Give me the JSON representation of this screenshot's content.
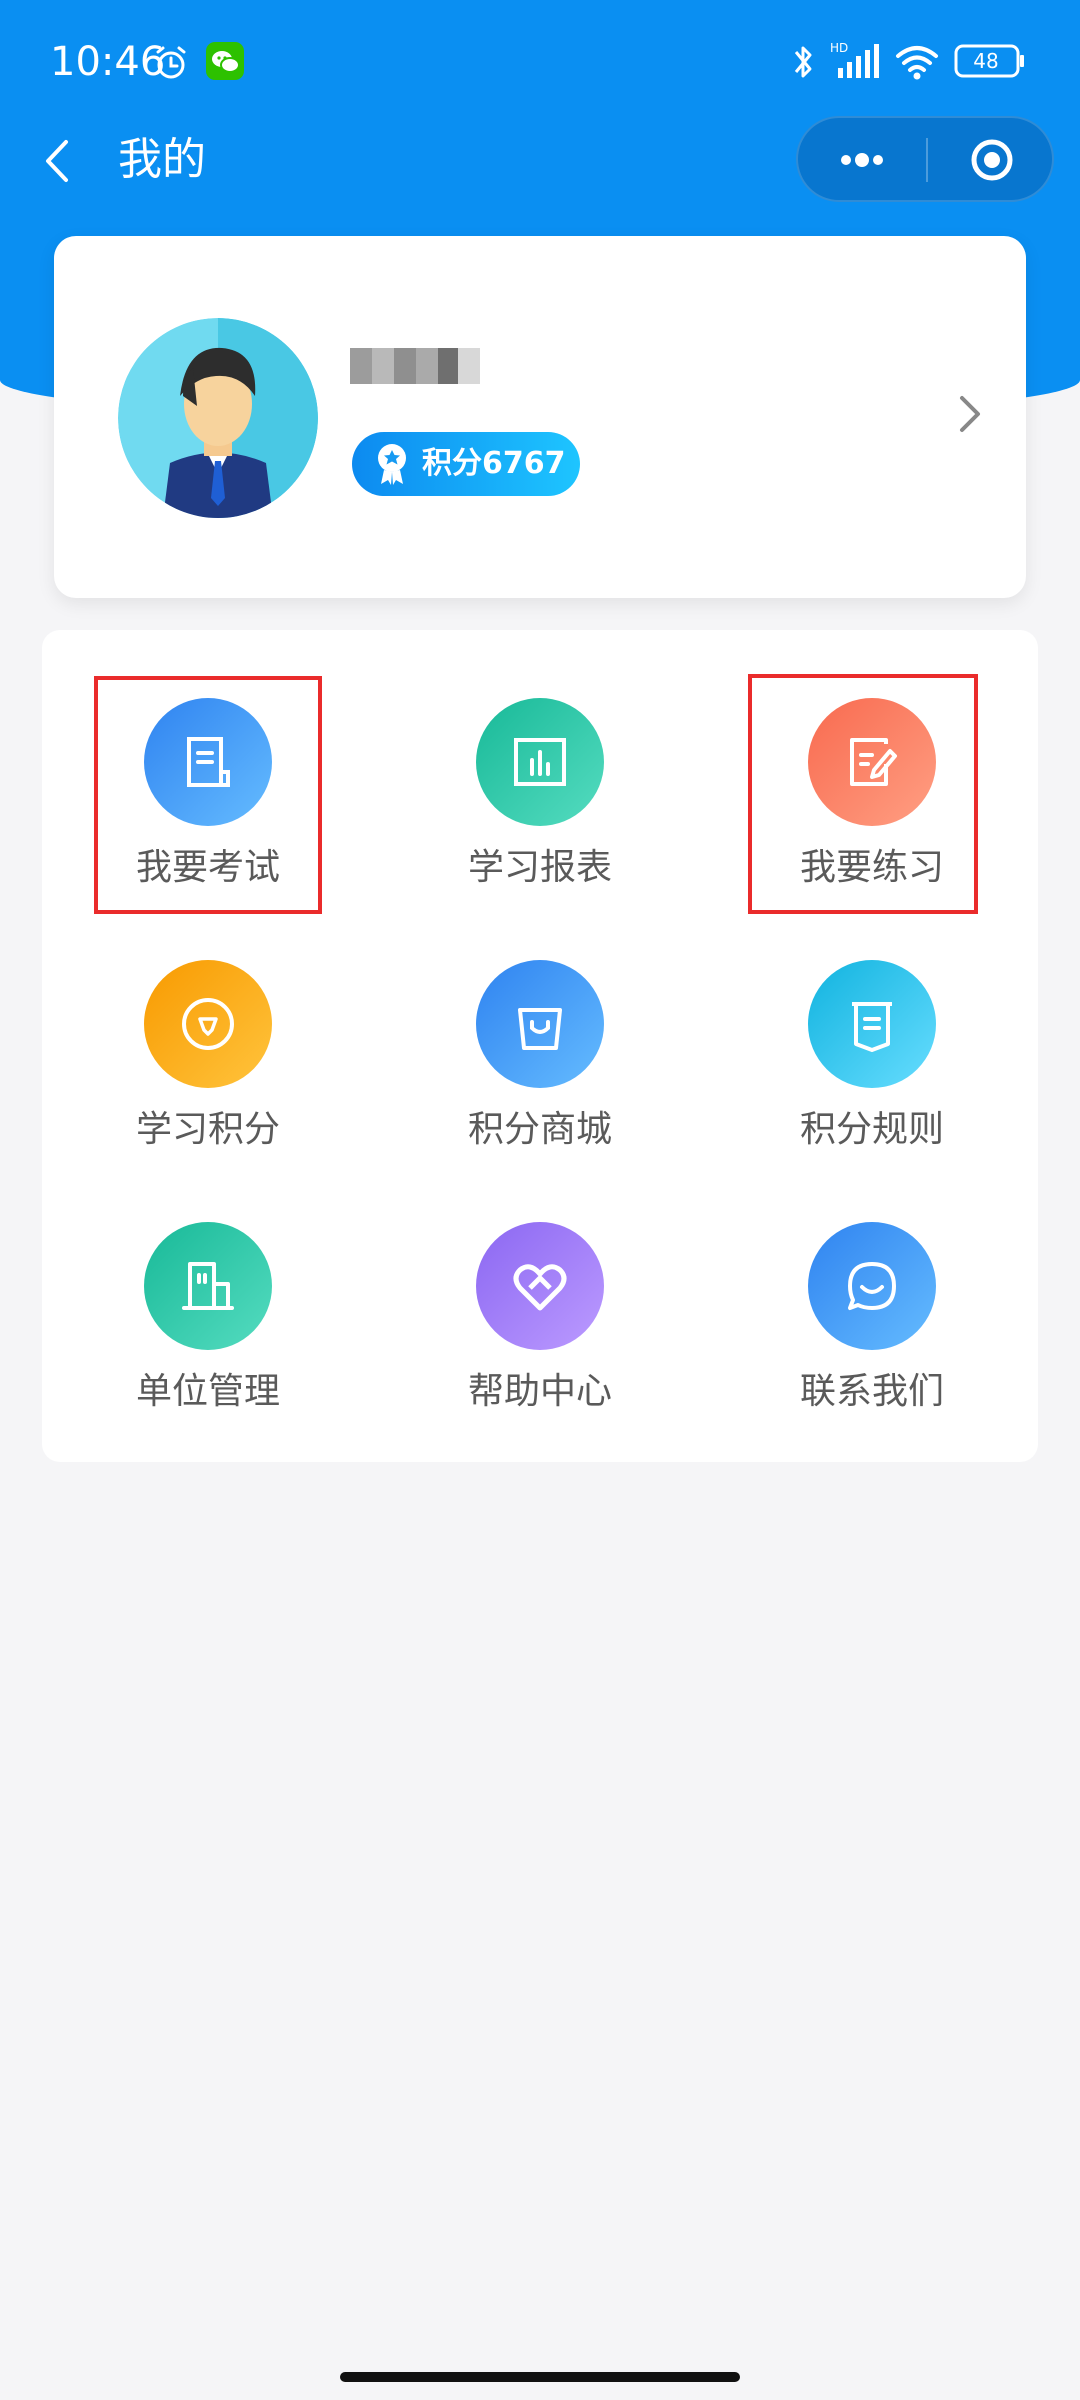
{
  "status_bar": {
    "time": "10:46",
    "battery": "48",
    "network_label": "HD"
  },
  "navigation": {
    "title": "我的"
  },
  "profile": {
    "points_label": "积分6767"
  },
  "menu": [
    {
      "label": "我要考试",
      "icon": "exam-doc-icon",
      "color": "#3f8ff3",
      "highlighted": true
    },
    {
      "label": "学习报表",
      "icon": "report-chart-icon",
      "color": "#24c7a8",
      "highlighted": false
    },
    {
      "label": "我要练习",
      "icon": "practice-edit-icon",
      "color": "#fb7a57",
      "highlighted": true
    },
    {
      "label": "学习积分",
      "icon": "diamond-icon",
      "color": "#f7a400",
      "highlighted": false
    },
    {
      "label": "积分商城",
      "icon": "shopping-bag-icon",
      "color": "#3f8ff3",
      "highlighted": false
    },
    {
      "label": "积分规则",
      "icon": "rules-scroll-icon",
      "color": "#21bfe7",
      "highlighted": false
    },
    {
      "label": "单位管理",
      "icon": "building-icon",
      "color": "#24c7a8",
      "highlighted": false
    },
    {
      "label": "帮助中心",
      "icon": "heart-help-icon",
      "color": "#9b74f1",
      "highlighted": false
    },
    {
      "label": "联系我们",
      "icon": "chat-bubble-icon",
      "color": "#3f8ff3",
      "highlighted": false
    }
  ]
}
